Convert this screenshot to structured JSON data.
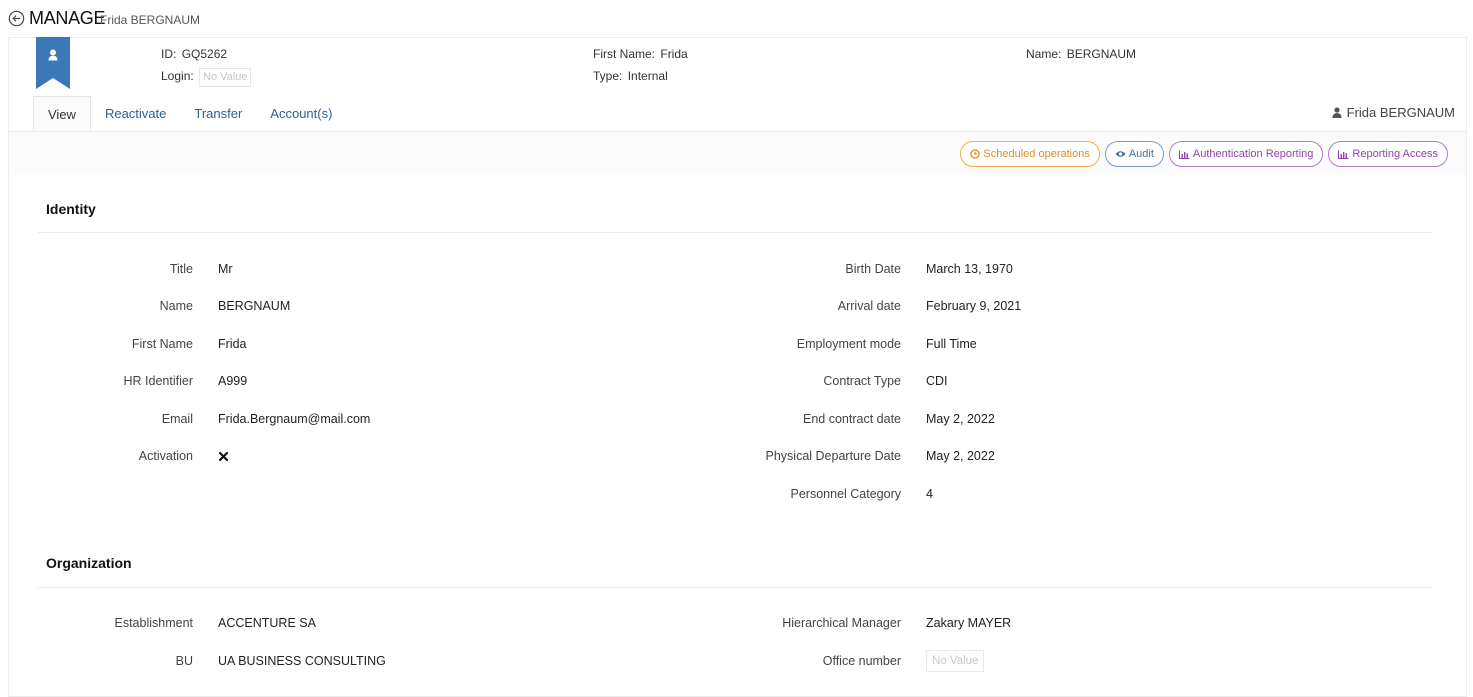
{
  "header": {
    "title": "MANAGE",
    "subtitle": "Frida BERGNAUM"
  },
  "summary": {
    "id_label": "ID:",
    "id_value": "GQ5262",
    "login_label": "Login:",
    "login_value": "No Value",
    "first_name_label": "First Name:",
    "first_name_value": "Frida",
    "type_label": "Type:",
    "type_value": "Internal",
    "name_label": "Name:",
    "name_value": "BERGNAUM"
  },
  "tabs": [
    {
      "label": "View",
      "active": true
    },
    {
      "label": "Reactivate",
      "active": false
    },
    {
      "label": "Transfer",
      "active": false
    },
    {
      "label": "Account(s)",
      "active": false
    }
  ],
  "current_user": "Frida BERGNAUM",
  "actions": {
    "scheduled": "Scheduled operations",
    "audit": "Audit",
    "auth_reporting": "Authentication Reporting",
    "reporting_access": "Reporting Access"
  },
  "identity": {
    "title": "Identity",
    "left": [
      {
        "label": "Title",
        "value": "Mr"
      },
      {
        "label": "Name",
        "value": "BERGNAUM"
      },
      {
        "label": "First Name",
        "value": "Frida"
      },
      {
        "label": "HR Identifier",
        "value": "A999"
      },
      {
        "label": "Email",
        "value": "Frida.Bergnaum@mail.com"
      },
      {
        "label": "Activation",
        "value": ""
      }
    ],
    "right": [
      {
        "label": "Birth Date",
        "value": "March 13, 1970"
      },
      {
        "label": "Arrival date",
        "value": "February 9, 2021"
      },
      {
        "label": "Employment mode",
        "value": "Full Time"
      },
      {
        "label": "Contract Type",
        "value": "CDI"
      },
      {
        "label": "End contract date",
        "value": "May 2, 2022"
      },
      {
        "label": "Physical Departure Date",
        "value": "May 2, 2022"
      },
      {
        "label": "Personnel Category",
        "value": "4"
      }
    ]
  },
  "organization": {
    "title": "Organization",
    "left": [
      {
        "label": "Establishment",
        "value": "ACCENTURE SA"
      },
      {
        "label": "BU",
        "value": "UA BUSINESS CONSULTING"
      }
    ],
    "right": [
      {
        "label": "Hierarchical Manager",
        "value": "Zakary MAYER"
      },
      {
        "label": "Office number",
        "value": "No Value"
      }
    ]
  },
  "colors": {
    "accent_blue": "#3a78b8",
    "link_blue": "#2b5f9a",
    "orange": "#e08a1e",
    "purple": "#8e44ad"
  }
}
